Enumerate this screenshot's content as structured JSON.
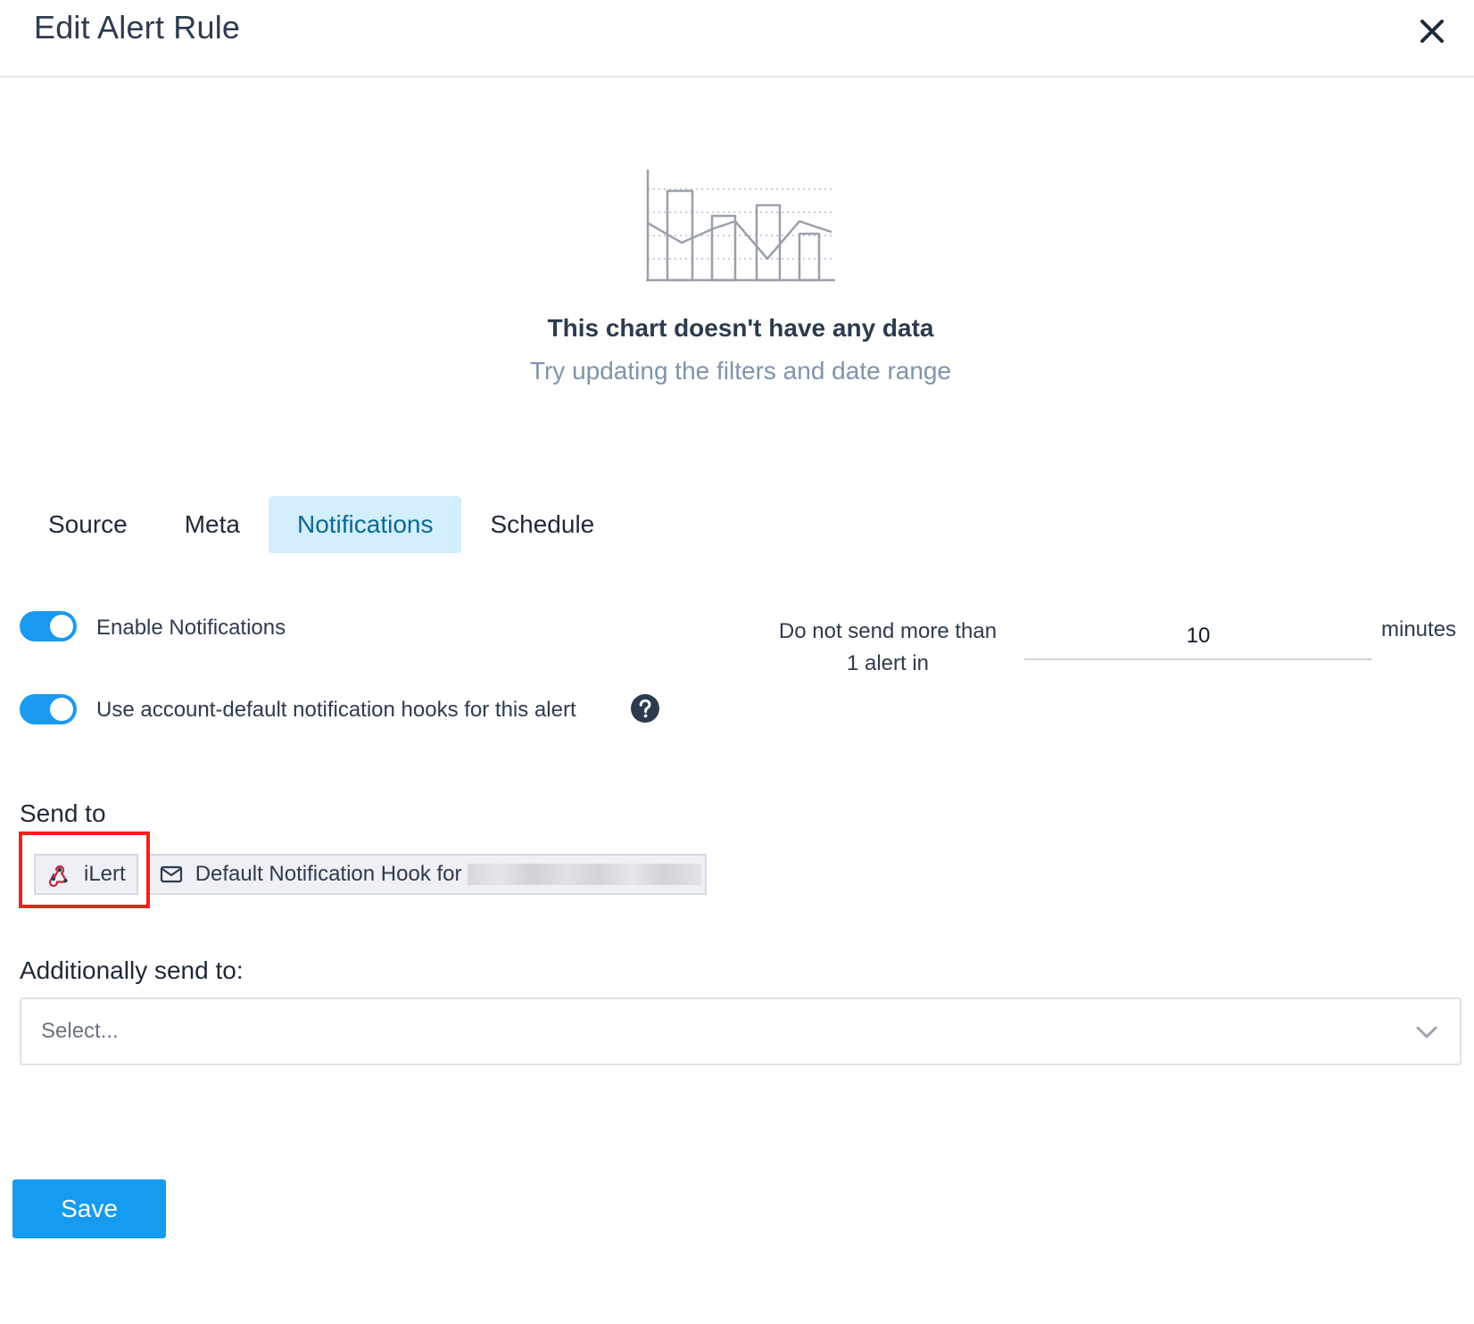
{
  "dialog": {
    "title": "Edit Alert Rule"
  },
  "empty_state": {
    "title": "This chart doesn't have any data",
    "subtitle": "Try updating the filters and date range",
    "icon": "empty-chart-illustration"
  },
  "tabs": [
    {
      "label": "Source",
      "active": false
    },
    {
      "label": "Meta",
      "active": false
    },
    {
      "label": "Notifications",
      "active": true
    },
    {
      "label": "Schedule",
      "active": false
    }
  ],
  "notifications": {
    "enable_label": "Enable Notifications",
    "enable_on": true,
    "use_default_label": "Use account-default notification hooks for this alert",
    "use_default_on": true,
    "throttle_label_line1": "Do not send more than",
    "throttle_label_line2": "1 alert in",
    "throttle_value": "10",
    "throttle_unit": "minutes"
  },
  "send_to": {
    "label": "Send to",
    "hooks": [
      {
        "label": "iLert",
        "icon": "webhook-icon"
      },
      {
        "label": "Default Notification Hook for",
        "icon": "envelope-icon"
      }
    ]
  },
  "additional": {
    "label": "Additionally send to:",
    "placeholder": "Select..."
  },
  "actions": {
    "save_label": "Save"
  },
  "colors": {
    "accent": "#1a9af0",
    "active_tab_bg": "#d3effd",
    "active_tab_text": "#086a9a",
    "highlight": "#f2201a"
  }
}
